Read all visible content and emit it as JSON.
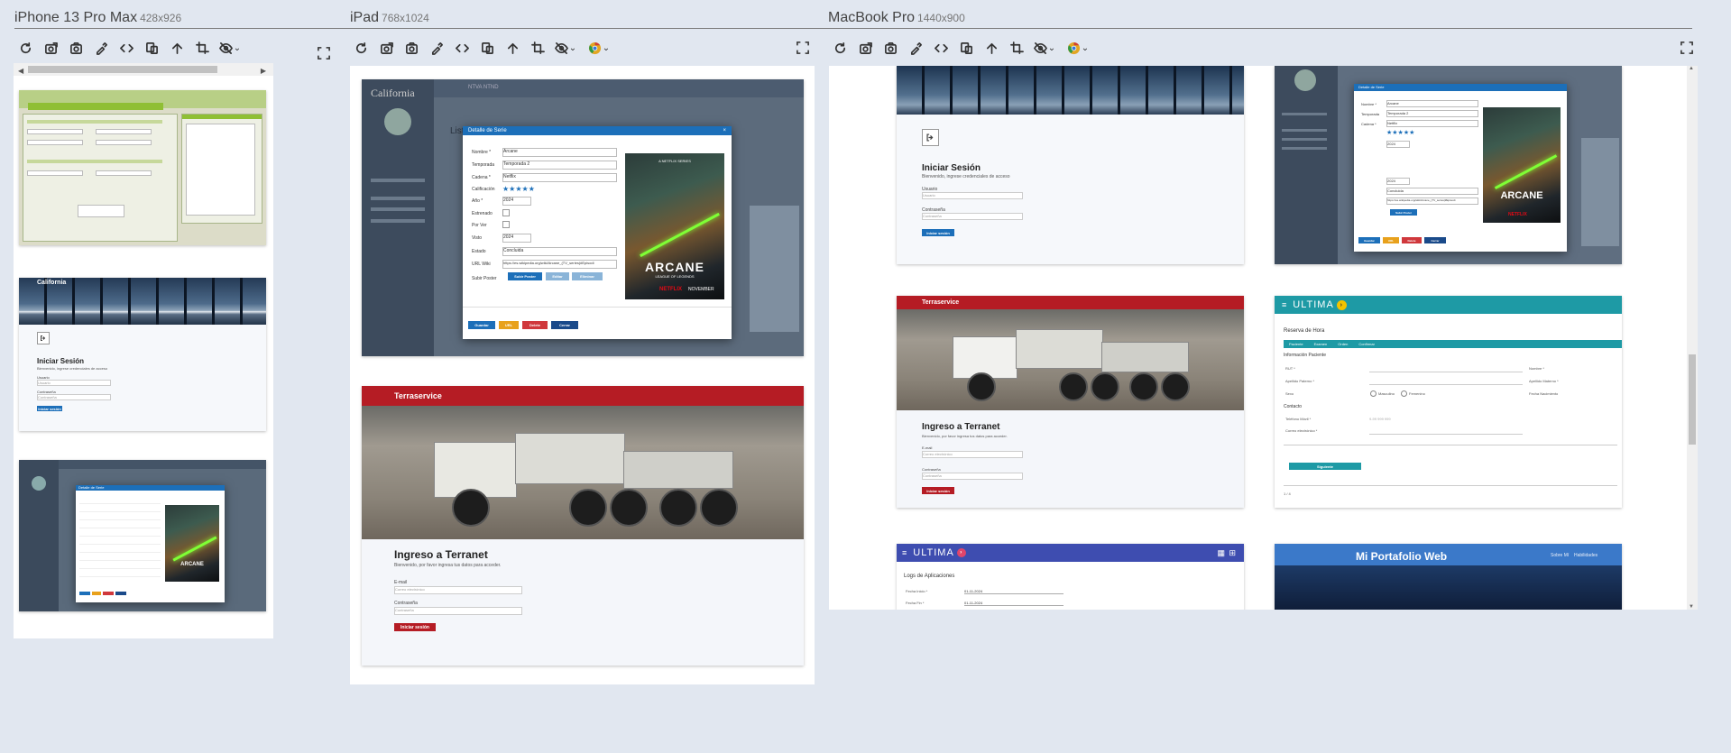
{
  "devices": [
    {
      "name": "iPhone 13 Pro Max",
      "dims": "428x926"
    },
    {
      "name": "iPad",
      "dims": "768x1024"
    },
    {
      "name": "MacBook Pro",
      "dims": "1440x900"
    }
  ],
  "colors": {
    "background": "#e1e7f0",
    "terra_red": "#b51c24",
    "modal_blue": "#1c6fb9",
    "ultima_teal": "#1e9aa5",
    "ultima_indigo": "#3e4db0",
    "portfolio_blue": "#3b79c9"
  },
  "toolbar_icons": [
    "refresh-icon",
    "screenshot-icon",
    "camera-icon",
    "eyedropper-icon",
    "code-icon",
    "copy-icon",
    "arrow-up-icon",
    "crop-icon",
    "eye-off-icon"
  ],
  "california": {
    "brand": "California"
  },
  "login_california": {
    "title": "Iniciar Sesión",
    "subtitle": "Bienvenido, ingrese credenciales de acceso",
    "user_label": "Usuario",
    "user_placeholder": "Usuario",
    "pass_label": "Contraseña",
    "pass_placeholder": "Contraseña",
    "button": "Iniciar sesión"
  },
  "modal": {
    "title": "Detalle de Serie",
    "fields": [
      {
        "label": "Nombre *",
        "value": "Arcane"
      },
      {
        "label": "Temporada",
        "value": "Temporada 2"
      },
      {
        "label": "Cadena *",
        "value": "Netflix"
      },
      {
        "label": "Calificación",
        "value": "★★★★★"
      },
      {
        "label": "Año *",
        "value": "2024"
      },
      {
        "label": "Estrenado",
        "value": ""
      },
      {
        "label": "Por Ver",
        "value": ""
      },
      {
        "label": "Visto",
        "value": "2024"
      },
      {
        "label": "Estado",
        "value": "Concluida"
      },
      {
        "label": "URL Wiki",
        "value": "https://es.wikipedia.org/wiki/Arcane_(TV_series)#Episodi"
      },
      {
        "label": "Subir Poster",
        "value": ""
      }
    ],
    "upload_buttons": [
      "Subir Poster",
      "Editar",
      "Eliminar"
    ],
    "footer_buttons": [
      "Guardar",
      "URL",
      "Delete",
      "Cerrar"
    ],
    "poster": {
      "brand": "A NETFLIX SERIES",
      "title": "ARCANE",
      "sub": "LEAGUE OF LEGENDS",
      "network": "NETFLIX",
      "month": "NOVEMBER"
    }
  },
  "ipad_page": {
    "list_title": "Listado de Series",
    "menu": "NTVA NTND"
  },
  "terra": {
    "brand": "Terraservice",
    "title": "Ingreso a Terranet",
    "subtitle": "Bienvenido, por favor ingresa tus datos para acceder.",
    "email_label": "E-mail",
    "email_placeholder": "Correo electrónico",
    "pass_label": "Contraseña",
    "pass_placeholder": "Contraseña",
    "button": "Iniciar sesión"
  },
  "ultima_reserva": {
    "brand": "ULTIMA",
    "title": "Reserva de Hora",
    "tabs": [
      "Paciente",
      "Examen",
      "Orden",
      "Confirmar"
    ],
    "section_patient": "Información Paciente",
    "fields_left": [
      "RUT *",
      "Apellido Paterno *",
      "Sexo"
    ],
    "fields_right": [
      "Nombre *",
      "Apellido Materno *",
      "Fecha Nacimiento"
    ],
    "sexo_options": [
      "Masculino",
      "Femenino"
    ],
    "section_contact": "Contacto",
    "contact_fields": [
      "Teléfono Móvil *",
      "Correo electrónico *"
    ],
    "phone_placeholder": "9-99 999 999",
    "next_button": "Siguiente",
    "pager": "1 / 4"
  },
  "ultima_logs": {
    "brand": "ULTIMA",
    "title": "Logs de Aplicaciones",
    "fields": [
      {
        "label": "Fecha Inicio *",
        "value": "01-11-2024"
      },
      {
        "label": "Fecha Fin *",
        "value": "01-11-2024"
      }
    ]
  },
  "portfolio": {
    "title": "Mi Portafolio Web",
    "nav": [
      "Sobre Mí",
      "Habilidades"
    ]
  }
}
